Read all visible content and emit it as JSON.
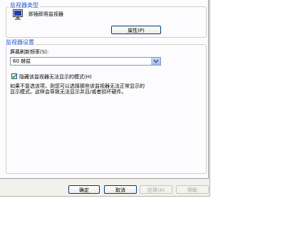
{
  "monitor_type": {
    "group_title": "监视器类型",
    "device_name": "即插即用监视器",
    "properties_button": "属性(P)",
    "icon": "monitor-icon"
  },
  "monitor_settings": {
    "group_title": "监视器设置",
    "refresh_rate_label": "屏幕刷新频率(S):",
    "refresh_rate_value": "60 赫兹",
    "hide_modes_checkbox": {
      "label": "隐藏该监视器无法显示的模式(H)",
      "checked": true
    },
    "warning_line1": "如果不复选该项，则您可以选择那些该监视器无法正常显示的",
    "warning_line2": "显示模式。这样会导致无法显示并且/或者损坏硬件。"
  },
  "footer": {
    "ok_button": "确定",
    "cancel_button": "取消",
    "apply_button": "应用(A)",
    "help_button": "帮助"
  },
  "colors": {
    "group_title": "#2457c8",
    "dialog_bg": "#f2f1ec",
    "panel_bg": "#fcfcfe",
    "button_border": "#003c74",
    "check_mark": "#21a121"
  }
}
